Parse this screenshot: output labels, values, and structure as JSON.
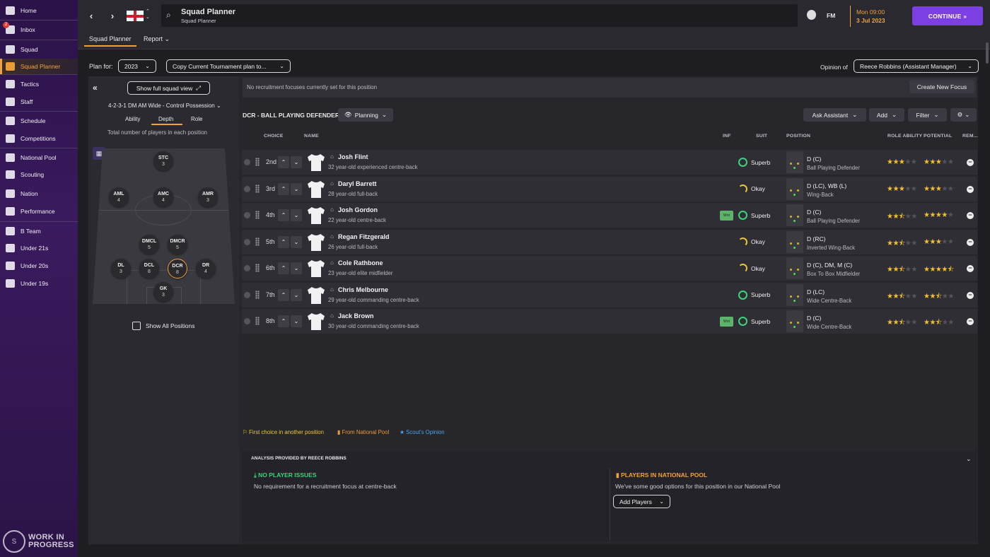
{
  "sidebar": {
    "items": [
      {
        "label": "Home",
        "icon": "home-icon"
      },
      {
        "label": "Inbox",
        "icon": "inbox-icon",
        "badge": "2"
      },
      {
        "label": "Squad",
        "icon": "shirt-icon"
      },
      {
        "label": "Squad Planner",
        "icon": "clipboard-icon",
        "active": true
      },
      {
        "label": "Tactics",
        "icon": "tactics-board-icon"
      },
      {
        "label": "Staff",
        "icon": "staff-icon"
      },
      {
        "label": "Schedule",
        "icon": "calendar-icon"
      },
      {
        "label": "Competitions",
        "icon": "trophy-icon"
      },
      {
        "label": "National Pool",
        "icon": "list-icon"
      },
      {
        "label": "Scouting",
        "icon": "search-icon"
      },
      {
        "label": "Nation",
        "icon": "shield-icon"
      },
      {
        "label": "Performance",
        "icon": "chart-icon"
      },
      {
        "label": "B Team",
        "icon": "team-icon"
      },
      {
        "label": "Under 21s",
        "icon": "team-icon"
      },
      {
        "label": "Under 20s",
        "icon": "team-icon"
      },
      {
        "label": "Under 19s",
        "icon": "team-icon"
      }
    ],
    "wip_line1": "WORK IN",
    "wip_line2": "PROGRESS"
  },
  "topbar": {
    "title": "Squad Planner",
    "subtitle": "Squad Planner",
    "fm": "FM",
    "date_line1": "Mon 09:00",
    "date_line2": "3 Jul 2023",
    "continue": "CONTINUE »"
  },
  "subnav": {
    "tab1": "Squad Planner",
    "tab2": "Report ⌄"
  },
  "controls": {
    "plan_for": "Plan for:",
    "year": "2023",
    "copy": "Copy Current Tournament plan to...",
    "opinion_of": "Opinion of",
    "opinion_person": "Reece Robbins (Assistant Manager)"
  },
  "left": {
    "full_view": "Show full squad view",
    "formation": "4-2-3-1 DM AM Wide - Control Possession",
    "tabs": [
      "Ability",
      "Depth",
      "Role"
    ],
    "caption": "Total number of players in each position",
    "positions": [
      {
        "code": "STC",
        "n": "3"
      },
      {
        "code": "AML",
        "n": "4"
      },
      {
        "code": "AMC",
        "n": "4"
      },
      {
        "code": "AMR",
        "n": "3"
      },
      {
        "code": "DMCL",
        "n": "5"
      },
      {
        "code": "DMCR",
        "n": "5"
      },
      {
        "code": "DL",
        "n": "3"
      },
      {
        "code": "DCL",
        "n": "8"
      },
      {
        "code": "DCR",
        "n": "8"
      },
      {
        "code": "DR",
        "n": "4"
      },
      {
        "code": "GK",
        "n": "3"
      }
    ],
    "show_all": "Show All Positions"
  },
  "main": {
    "no_focus": "No recruitment focuses currently set for this position",
    "create_focus": "Create New Focus",
    "position_title": "DCR - BALL PLAYING DEFENDER",
    "planning": "Planning",
    "ask": "Ask Assistant",
    "add": "Add",
    "filter": "Filter",
    "columns": {
      "choice": "CHOICE",
      "name": "NAME",
      "inf": "INF",
      "suit": "SUIT",
      "position": "POSITION",
      "role_ability": "ROLE ABILITY",
      "potential": "POTENTIAL",
      "rem": "REM..."
    },
    "players": [
      {
        "choice": "2nd",
        "name": "Josh Flint",
        "desc": "32 year-old experienced centre-back",
        "inf": "",
        "suit": "Superb",
        "pos": "D (C)",
        "role": "Ball Playing Defender",
        "ability": 3,
        "potential": 3
      },
      {
        "choice": "3rd",
        "name": "Daryl Barrett",
        "desc": "28 year-old full-back",
        "inf": "",
        "suit": "Okay",
        "pos": "D (LC), WB (L)",
        "role": "Wing-Back",
        "ability": 3,
        "potential": 3
      },
      {
        "choice": "4th",
        "name": "Josh Gordon",
        "desc": "22 year-old centre-back",
        "inf": "Wnt",
        "suit": "Superb",
        "pos": "D (C)",
        "role": "Ball Playing Defender",
        "ability": 2.5,
        "potential": 4
      },
      {
        "choice": "5th",
        "name": "Regan Fitzgerald",
        "desc": "26 year-old full-back",
        "inf": "",
        "suit": "Okay",
        "pos": "D (RC)",
        "role": "Inverted Wing-Back",
        "ability": 2.5,
        "potential": 3
      },
      {
        "choice": "6th",
        "name": "Cole Rathbone",
        "desc": "23 year-old elite midfielder",
        "inf": "",
        "suit": "Okay",
        "pos": "D (C), DM, M (C)",
        "role": "Box To Box Midfielder",
        "ability": 2.5,
        "potential": 4.5
      },
      {
        "choice": "7th",
        "name": "Chris Melbourne",
        "desc": "29 year-old commanding centre-back",
        "inf": "",
        "suit": "Superb",
        "pos": "D (LC)",
        "role": "Wide Centre-Back",
        "ability": 2.5,
        "potential": 2.5
      },
      {
        "choice": "8th",
        "name": "Jack Brown",
        "desc": "30 year-old commanding centre-back",
        "inf": "Wnt",
        "suit": "Superb",
        "pos": "D (C)",
        "role": "Wide Centre-Back",
        "ability": 2.5,
        "potential": 2.5
      }
    ],
    "legend": [
      {
        "text": "First choice in another position",
        "color": "#e8c832"
      },
      {
        "text": "From National Pool",
        "color": "#e89a3a"
      },
      {
        "text": "Scout's Opinion",
        "color": "#4aa3e8"
      }
    ]
  },
  "analysis": {
    "header": "ANALYSIS PROVIDED BY REECE ROBBINS",
    "left_title": "NO PLAYER ISSUES",
    "left_text": "No requirement for a recruitment focus at centre-back",
    "right_title": "PLAYERS IN NATIONAL POOL",
    "right_text": "We've some good options for this position in our National Pool",
    "add_players": "Add Players"
  },
  "colors": {
    "accent": "#7b3fe3",
    "highlight": "#f0a238",
    "good": "#3cd37a",
    "okay": "#e8c832"
  }
}
